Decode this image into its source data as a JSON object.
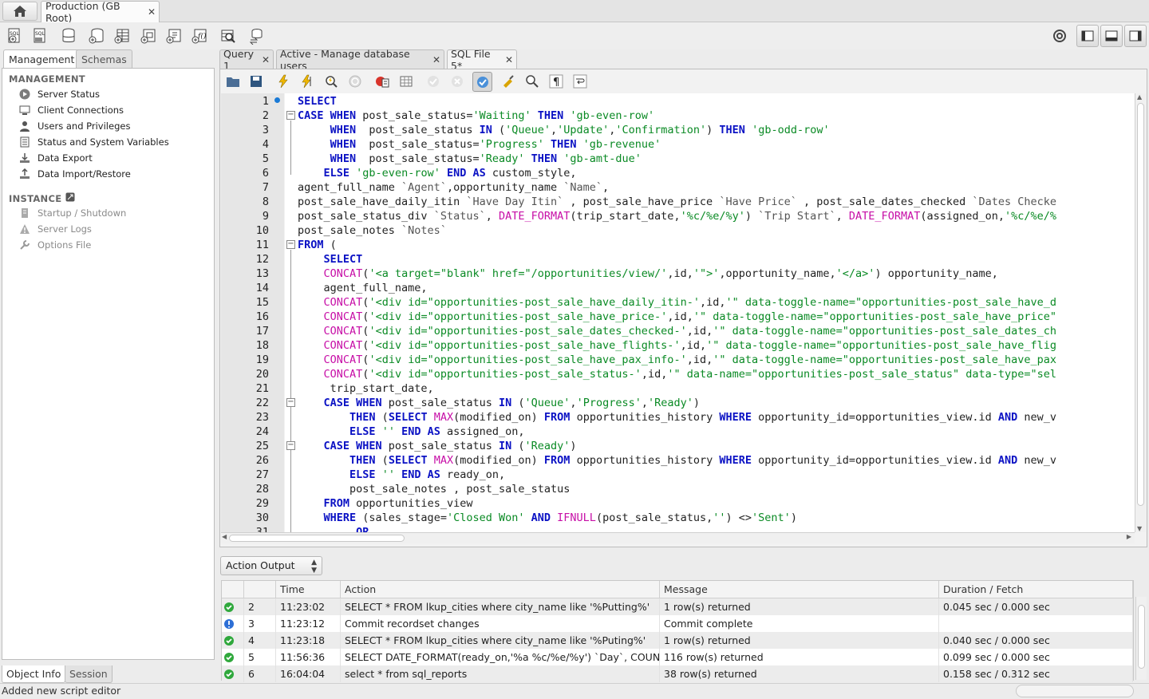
{
  "connection_tab": {
    "label": "Production (GB Root)"
  },
  "sidebar": {
    "tabs": [
      "Management",
      "Schemas"
    ],
    "management_header": "MANAGEMENT",
    "management_items": [
      "Server Status",
      "Client Connections",
      "Users and Privileges",
      "Status and System Variables",
      "Data Export",
      "Data Import/Restore"
    ],
    "instance_header": "INSTANCE",
    "instance_items": [
      "Startup / Shutdown",
      "Server Logs",
      "Options File"
    ],
    "bottom_tabs": [
      "Object Info",
      "Session"
    ]
  },
  "editor_tabs": [
    {
      "label": "Query 1"
    },
    {
      "label": "Active - Manage database users"
    },
    {
      "label": "SQL File 5*"
    }
  ],
  "line_numbers": [
    "1",
    "2",
    "3",
    "4",
    "5",
    "6",
    "7",
    "8",
    "9",
    "10",
    "11",
    "12",
    "13",
    "14",
    "15",
    "16",
    "17",
    "18",
    "19",
    "20",
    "21",
    "22",
    "23",
    "24",
    "25",
    "26",
    "27",
    "28",
    "29",
    "30",
    "31"
  ],
  "code_lines": [
    "[[k:SELECT]]",
    "[[k:CASE WHEN]] post_sale_status=[[s:'Waiting']] [[k:THEN]] [[s:'gb-even-row']]",
    "     [[k:WHEN]]  post_sale_status [[k:IN]] ([[s:'Queue']],[[s:'Update']],[[s:'Confirmation']]) [[k:THEN]] [[s:'gb-odd-row']]",
    "     [[k:WHEN]]  post_sale_status=[[s:'Progress']] [[k:THEN]] [[s:'gb-revenue']]",
    "     [[k:WHEN]]  post_sale_status=[[s:'Ready']] [[k:THEN]] [[s:'gb-amt-due']]",
    "    [[k:ELSE]] [[s:'gb-even-row']] [[k:END AS]] custom_style,",
    "agent_full_name [[q:`Agent`]],opportunity_name [[q:`Name`]],",
    "post_sale_have_daily_itin [[q:`Have Day Itin`]] , post_sale_have_price [[q:`Have Price`]] , post_sale_dates_checked [[q:`Dates Checke]]",
    "post_sale_status_div [[q:`Status`]], [[f:DATE_FORMAT]](trip_start_date,[[s:'%c/%e/%y']]) [[q:`Trip Start`]], [[f:DATE_FORMAT]](assigned_on,[[s:'%c/%e/%]]",
    "post_sale_notes [[q:`Notes`]]",
    "[[k:FROM]] (",
    "    [[k:SELECT]]",
    "    [[f:CONCAT]]([[s:'<a target=\"blank\" href=\"/opportunities/view/']],id,[[s:'\">']],opportunity_name,[[s:'</a>']]) opportunity_name,",
    "    agent_full_name,",
    "    [[f:CONCAT]]([[s:'<div id=\"opportunities-post_sale_have_daily_itin-']],id,[[s:'\" data-toggle-name=\"opportunities-post_sale_have_d]]",
    "    [[f:CONCAT]]([[s:'<div id=\"opportunities-post_sale_have_price-']],id,[[s:'\" data-toggle-name=\"opportunities-post_sale_have_price\"]]",
    "    [[f:CONCAT]]([[s:'<div id=\"opportunities-post_sale_dates_checked-']],id,[[s:'\" data-toggle-name=\"opportunities-post_sale_dates_ch]]",
    "    [[f:CONCAT]]([[s:'<div id=\"opportunities-post_sale_have_flights-']],id,[[s:'\" data-toggle-name=\"opportunities-post_sale_have_flig]]",
    "    [[f:CONCAT]]([[s:'<div id=\"opportunities-post_sale_have_pax_info-']],id,[[s:'\" data-toggle-name=\"opportunities-post_sale_have_pax]]",
    "    [[f:CONCAT]]([[s:'<div id=\"opportunities-post_sale_status-']],id,[[s:'\" data-name=\"opportunities-post_sale_status\" data-type=\"sel]]",
    "     trip_start_date,",
    "    [[k:CASE WHEN]] post_sale_status [[k:IN]] ([[s:'Queue']],[[s:'Progress']],[[s:'Ready']])",
    "        [[k:THEN]] ([[k:SELECT]] [[f:MAX]](modified_on) [[k:FROM]] opportunities_history [[k:WHERE]] opportunity_id=opportunities_view.id [[k:AND]] new_v",
    "        [[k:ELSE]] [[s:'']] [[k:END AS]] assigned_on,",
    "    [[k:CASE WHEN]] post_sale_status [[k:IN]] ([[s:'Ready']])",
    "        [[k:THEN]] ([[k:SELECT]] [[f:MAX]](modified_on) [[k:FROM]] opportunities_history [[k:WHERE]] opportunity_id=opportunities_view.id [[k:AND]] new_v",
    "        [[k:ELSE]] [[s:'']] [[k:END AS]] ready_on,",
    "        post_sale_notes , post_sale_status",
    "    [[k:FROM]] opportunities_view",
    "    [[k:WHERE]] (sales_stage=[[s:'Closed Won']] [[k:AND]] [[f:IFNULL]](post_sale_status,[[s:'']]) <>[[s:'Sent']])",
    "         [[k:OR]]"
  ],
  "output": {
    "selector_label": "Action Output",
    "columns": [
      "",
      "",
      "Time",
      "Action",
      "Message",
      "Duration / Fetch"
    ],
    "rows": [
      {
        "status": "ok",
        "num": "2",
        "time": "11:23:02",
        "action": "SELECT * FROM lkup_cities where city_name like '%Putting%'",
        "message": "1 row(s) returned",
        "duration": "0.045 sec / 0.000 sec"
      },
      {
        "status": "info",
        "num": "3",
        "time": "11:23:12",
        "action": "Commit recordset changes",
        "message": "Commit complete",
        "duration": ""
      },
      {
        "status": "ok",
        "num": "4",
        "time": "11:23:18",
        "action": "SELECT * FROM lkup_cities where city_name like '%Puting%'",
        "message": "1 row(s) returned",
        "duration": "0.040 sec / 0.000 sec"
      },
      {
        "status": "ok",
        "num": "5",
        "time": "11:56:36",
        "action": "SELECT DATE_FORMAT(ready_on,'%a %c/%e/%y') `Day`,  COUNT(",
        "message": "116 row(s) returned",
        "duration": "0.099 sec / 0.000 sec"
      },
      {
        "status": "ok",
        "num": "6",
        "time": "16:04:04",
        "action": "select * from sql_reports",
        "message": "38 row(s) returned",
        "duration": "0.158 sec / 0.312 sec"
      }
    ]
  },
  "status_bar": {
    "text": "Added new script editor"
  },
  "colors": {
    "keyword": "#0b12c4",
    "string": "#0a8a24",
    "function": "#c70fa7",
    "ok": "#2fa83c",
    "info": "#2d6fd6"
  },
  "icons": [
    "home-icon",
    "new-sql-tab-icon",
    "open-sql-file-icon",
    "schema-inspector-icon",
    "create-schema-icon",
    "create-table-icon",
    "create-view-icon",
    "create-procedure-icon",
    "create-function-icon",
    "search-table-icon",
    "reconnect-icon",
    "settings-icon",
    "toggle-sidebar-icon",
    "toggle-output-icon",
    "toggle-secondary-sidebar-icon"
  ]
}
